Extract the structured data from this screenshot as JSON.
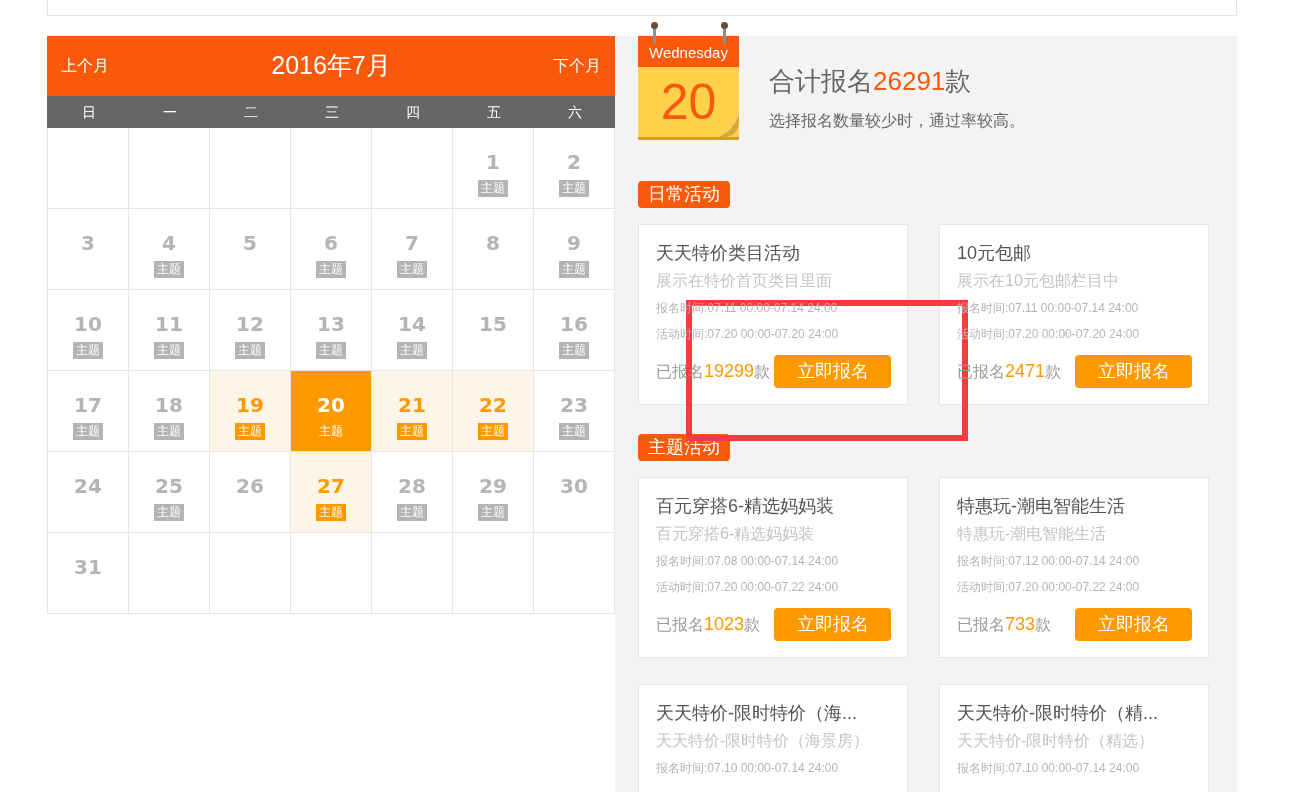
{
  "calendar": {
    "prev_label": "上个月",
    "title": "2016年7月",
    "next_label": "下个月",
    "weekdays": [
      "日",
      "一",
      "二",
      "三",
      "四",
      "五",
      "六"
    ],
    "weeks": [
      [
        {
          "kind": "blank"
        },
        {
          "kind": "blank"
        },
        {
          "kind": "blank"
        },
        {
          "kind": "blank"
        },
        {
          "kind": "blank"
        },
        {
          "kind": "day",
          "day": "1",
          "badge": "主题",
          "open": false,
          "selected": false
        },
        {
          "kind": "day",
          "day": "2",
          "badge": "主题",
          "open": false,
          "selected": false
        }
      ],
      [
        {
          "kind": "day",
          "day": "3",
          "open": false,
          "selected": false
        },
        {
          "kind": "day",
          "day": "4",
          "badge": "主题",
          "open": false,
          "selected": false
        },
        {
          "kind": "day",
          "day": "5",
          "open": false,
          "selected": false
        },
        {
          "kind": "day",
          "day": "6",
          "badge": "主题",
          "open": false,
          "selected": false
        },
        {
          "kind": "day",
          "day": "7",
          "badge": "主题",
          "open": false,
          "selected": false
        },
        {
          "kind": "day",
          "day": "8",
          "open": false,
          "selected": false
        },
        {
          "kind": "day",
          "day": "9",
          "badge": "主题",
          "open": false,
          "selected": false
        }
      ],
      [
        {
          "kind": "day",
          "day": "10",
          "badge": "主题",
          "open": false,
          "selected": false
        },
        {
          "kind": "day",
          "day": "11",
          "badge": "主题",
          "open": false,
          "selected": false
        },
        {
          "kind": "day",
          "day": "12",
          "badge": "主题",
          "open": false,
          "selected": false
        },
        {
          "kind": "day",
          "day": "13",
          "badge": "主题",
          "open": false,
          "selected": false
        },
        {
          "kind": "day",
          "day": "14",
          "badge": "主题",
          "open": false,
          "selected": false
        },
        {
          "kind": "day",
          "day": "15",
          "open": false,
          "selected": false
        },
        {
          "kind": "day",
          "day": "16",
          "badge": "主题",
          "open": false,
          "selected": false
        }
      ],
      [
        {
          "kind": "day",
          "day": "17",
          "badge": "主题",
          "open": false,
          "selected": false
        },
        {
          "kind": "day",
          "day": "18",
          "badge": "主题",
          "open": false,
          "selected": false
        },
        {
          "kind": "day",
          "day": "19",
          "badge": "主题",
          "open": true,
          "selected": false
        },
        {
          "kind": "day",
          "day": "20",
          "badge": "主题",
          "open": true,
          "selected": true
        },
        {
          "kind": "day",
          "day": "21",
          "badge": "主题",
          "open": true,
          "selected": false
        },
        {
          "kind": "day",
          "day": "22",
          "badge": "主题",
          "open": true,
          "selected": false
        },
        {
          "kind": "day",
          "day": "23",
          "badge": "主题",
          "open": false,
          "selected": false
        }
      ],
      [
        {
          "kind": "day",
          "day": "24",
          "open": false,
          "selected": false
        },
        {
          "kind": "day",
          "day": "25",
          "badge": "主题",
          "open": false,
          "selected": false
        },
        {
          "kind": "day",
          "day": "26",
          "open": false,
          "selected": false
        },
        {
          "kind": "day",
          "day": "27",
          "badge": "主题",
          "open": true,
          "selected": false
        },
        {
          "kind": "day",
          "day": "28",
          "badge": "主题",
          "open": false,
          "selected": false
        },
        {
          "kind": "day",
          "day": "29",
          "badge": "主题",
          "open": false,
          "selected": false
        },
        {
          "kind": "day",
          "day": "30",
          "open": false,
          "selected": false
        }
      ],
      [
        {
          "kind": "day",
          "day": "31",
          "open": false,
          "selected": false
        },
        {
          "kind": "blank"
        },
        {
          "kind": "blank"
        },
        {
          "kind": "blank"
        },
        {
          "kind": "blank"
        },
        {
          "kind": "blank"
        },
        {
          "kind": "blank"
        }
      ]
    ]
  },
  "summary": {
    "weekday": "Wednesday",
    "day": "20",
    "total_prefix": "合计报名",
    "total": "26291",
    "total_suffix": "款",
    "hint": "选择报名数量较少时，通过率较高。"
  },
  "sections": [
    {
      "tag": "日常活动",
      "cards": [
        {
          "title": "天天特价类目活动",
          "subtitle": "展示在特价首页类目里面",
          "signup_time": "报名时间:07.11 00:00-07.14 24:00",
          "activity_time": "活动时间:07.20 00:00-07.20 24:00",
          "count_prefix": "已报名",
          "count": "19299",
          "count_suffix": "款",
          "button": "立即报名"
        },
        {
          "title": "10元包邮",
          "subtitle": "展示在10元包邮栏目中",
          "signup_time": "报名时间:07.11 00:00-07.14 24:00",
          "activity_time": "活动时间:07.20 00:00-07.20 24:00",
          "count_prefix": "已报名",
          "count": "2471",
          "count_suffix": "款",
          "button": "立即报名"
        }
      ]
    },
    {
      "tag": "主题活动",
      "cards": [
        {
          "title": "百元穿搭6-精选妈妈装",
          "subtitle": "百元穿搭6-精选妈妈装",
          "signup_time": "报名时间:07.08 00:00-07.14 24:00",
          "activity_time": "活动时间:07.20 00:00-07.22 24:00",
          "count_prefix": "已报名",
          "count": "1023",
          "count_suffix": "款",
          "button": "立即报名"
        },
        {
          "title": "特惠玩-潮电智能生活",
          "subtitle": "特惠玩-潮电智能生活",
          "signup_time": "报名时间:07.12 00:00-07.14 24:00",
          "activity_time": "活动时间:07.20 00:00-07.22 24:00",
          "count_prefix": "已报名",
          "count": "733",
          "count_suffix": "款",
          "button": "立即报名"
        },
        {
          "title": "天天特价-限时特价（海...",
          "subtitle": "天天特价-限时特价（海景房）",
          "signup_time": "报名时间:07.10 00:00-07.14 24:00"
        },
        {
          "title": "天天特价-限时特价（精...",
          "subtitle": "天天特价-限时特价（精选）",
          "signup_time": "报名时间:07.10 00:00-07.14 24:00"
        }
      ]
    }
  ],
  "annotation": {
    "kind": "frame"
  }
}
